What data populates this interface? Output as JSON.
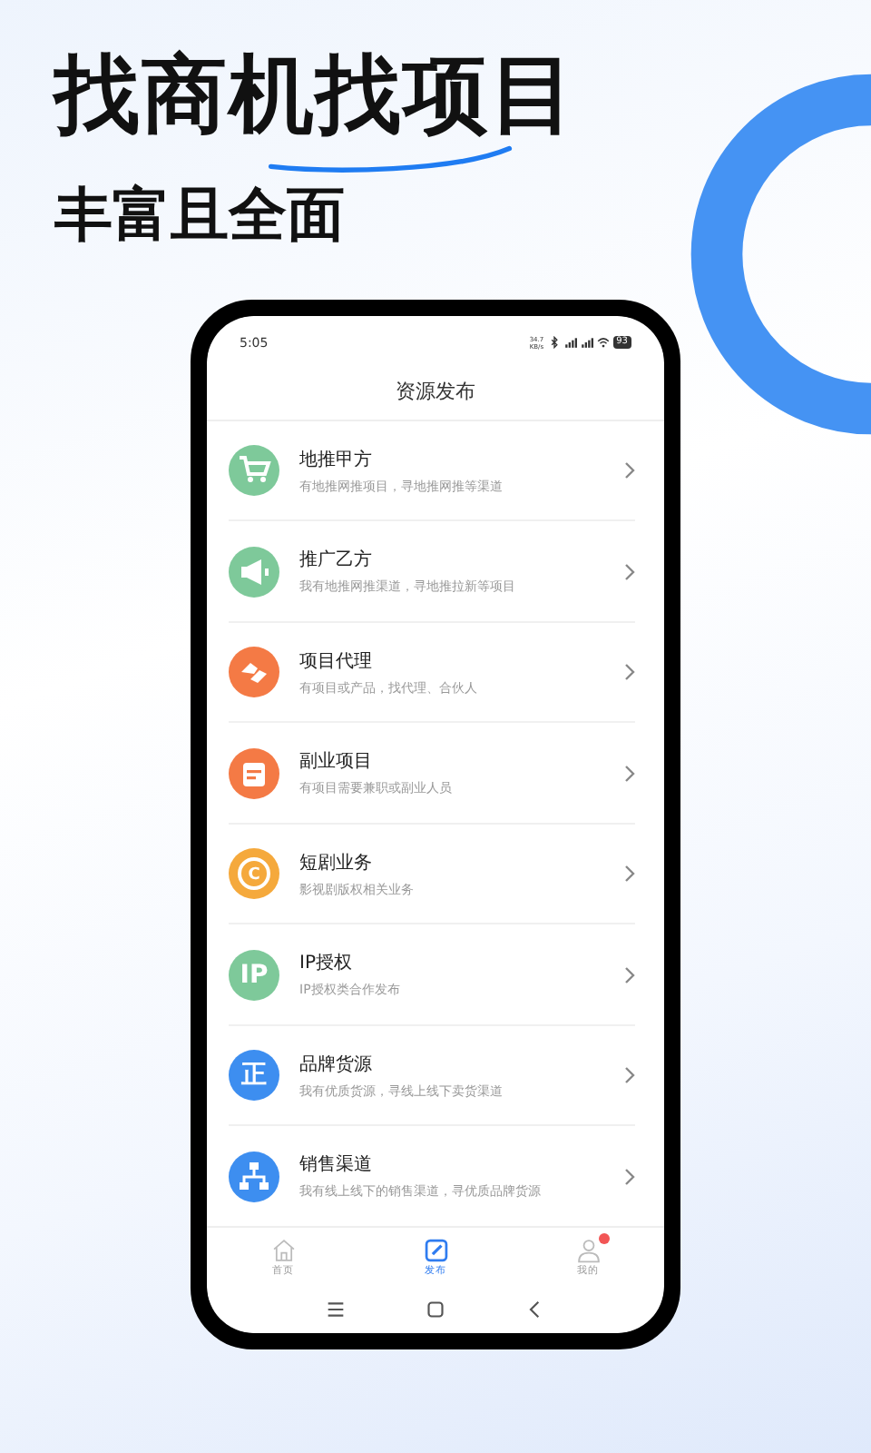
{
  "headline": {
    "title": "找商机找项目",
    "subtitle": "丰富且全面"
  },
  "status_bar": {
    "time": "5:05",
    "speed": "34.7",
    "speed_unit": "KB/s",
    "battery": "93"
  },
  "header": {
    "title": "资源发布"
  },
  "items": [
    {
      "kind": "cart",
      "color": "#7ec99a",
      "title": "地推甲方",
      "desc": "有地推网推项目，寻地推网推等渠道"
    },
    {
      "kind": "megaphone",
      "color": "#7ec99a",
      "title": "推广乙方",
      "desc": "我有地推网推渠道，寻地推拉新等项目"
    },
    {
      "kind": "handshake",
      "color": "#f47a45",
      "title": "项目代理",
      "desc": "有项目或产品，找代理、合伙人"
    },
    {
      "kind": "calendar",
      "color": "#f47a45",
      "title": "副业项目",
      "desc": "有项目需要兼职或副业人员"
    },
    {
      "kind": "glyph",
      "glyph": "C",
      "ring": true,
      "color": "#f5a93c",
      "title": "短剧业务",
      "desc": "影视剧版权相关业务"
    },
    {
      "kind": "glyph",
      "glyph": "IP",
      "color": "#7ec99a",
      "title": "IP授权",
      "desc": "IP授权类合作发布"
    },
    {
      "kind": "glyph",
      "glyph": "正",
      "color": "#3d8ef0",
      "title": "品牌货源",
      "desc": "我有优质货源，寻线上线下卖货渠道"
    },
    {
      "kind": "org",
      "color": "#3d8ef0",
      "title": "销售渠道",
      "desc": "我有线上线下的销售渠道，寻优质品牌货源"
    }
  ],
  "tabs": [
    {
      "kind": "home",
      "label": "首页",
      "selected": false,
      "badge": false
    },
    {
      "kind": "edit",
      "label": "发布",
      "selected": true,
      "badge": false
    },
    {
      "kind": "person",
      "label": "我的",
      "selected": false,
      "badge": true
    }
  ]
}
